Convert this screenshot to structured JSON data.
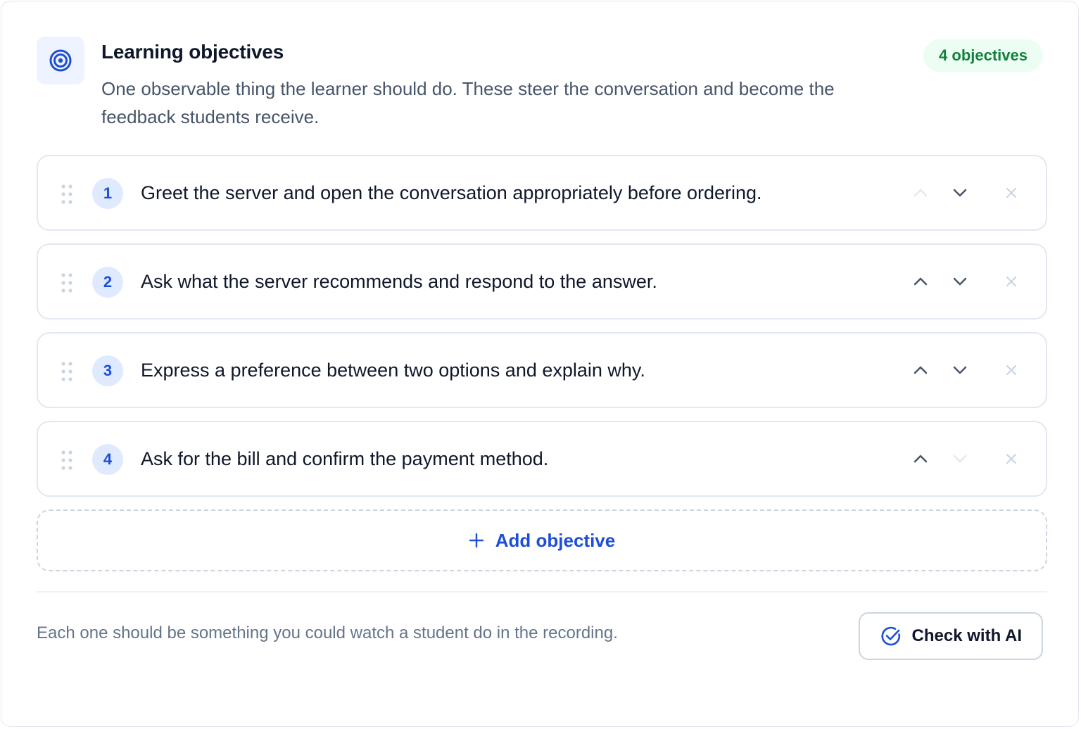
{
  "header": {
    "icon": "target-icon",
    "title": "Learning objectives",
    "subtitle": "One observable thing the learner should do. These steer the conversation and become the feedback students receive.",
    "count_badge": "4 objectives"
  },
  "objectives": [
    {
      "number": "1",
      "text": "Greet the server and open the conversation appropriately before ordering.",
      "up_enabled": false,
      "down_enabled": true
    },
    {
      "number": "2",
      "text": "Ask what the server recommends and respond to the answer.",
      "up_enabled": true,
      "down_enabled": true
    },
    {
      "number": "3",
      "text": "Express a preference between two options and explain why.",
      "up_enabled": true,
      "down_enabled": true
    },
    {
      "number": "4",
      "text": "Ask for the bill and confirm the payment method.",
      "up_enabled": true,
      "down_enabled": false
    }
  ],
  "add_button": {
    "label": "Add objective",
    "icon": "plus-icon"
  },
  "footer": {
    "note": "Each one should be something you could watch a student do in the recording.",
    "check_button": {
      "label": "Check with AI",
      "icon": "check-circle-icon"
    }
  },
  "colors": {
    "accent": "#1d4ed8",
    "badge_bg": "#ecfdf3",
    "badge_text": "#15803d",
    "border": "#e2e8f0",
    "muted_text": "#64748b"
  }
}
